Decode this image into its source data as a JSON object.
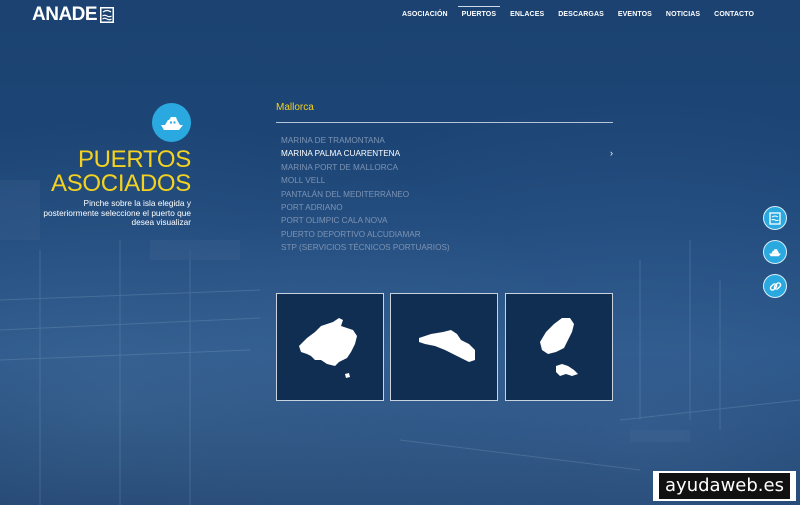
{
  "brand": {
    "logo_text": "ANADE"
  },
  "nav": [
    {
      "label": "ASOCIACIÓN"
    },
    {
      "label": "PUERTOS"
    },
    {
      "label": "ENLACES"
    },
    {
      "label": "DESCARGAS"
    },
    {
      "label": "EVENTOS"
    },
    {
      "label": "NOTICIAS"
    },
    {
      "label": "CONTACTO"
    }
  ],
  "nav_active": "PUERTOS",
  "hero": {
    "title_line1": "PUERTOS",
    "title_line2": "ASOCIADOS",
    "description": "Pinche sobre la isla elegida y posteriormente seleccione el puerto que desea visualizar",
    "icon": "boat-icon"
  },
  "region": "Mallorca",
  "ports": [
    {
      "label": "MARINA DE TRAMONTANA"
    },
    {
      "label": "MARINA PALMA CUARENTENA"
    },
    {
      "label": "MARINA PORT DE MALLORCA"
    },
    {
      "label": "MOLL VELL"
    },
    {
      "label": "PANTALÁN DEL MEDITERRÁNEO"
    },
    {
      "label": "PORT ADRIANO"
    },
    {
      "label": "PORT OLIMPIC CALA NOVA"
    },
    {
      "label": "PUERTO DEPORTIVO ALCUDIAMAR"
    },
    {
      "label": "STP (SERVICIOS TÉCNICOS PORTUARIOS)"
    }
  ],
  "selected_port": "MARINA PALMA CUARENTENA",
  "islands": [
    {
      "icon": "mallorca-map-icon"
    },
    {
      "icon": "menorca-map-icon"
    },
    {
      "icon": "ibiza-formentera-map-icon"
    }
  ],
  "side_buttons": [
    {
      "icon": "building-icon"
    },
    {
      "icon": "boat-icon"
    },
    {
      "icon": "link-icon"
    }
  ],
  "watermark": "ayudaweb.es",
  "colors": {
    "accent_yellow": "#f4d21f",
    "accent_blue": "#2aa9e0",
    "background": "#1d4677"
  }
}
